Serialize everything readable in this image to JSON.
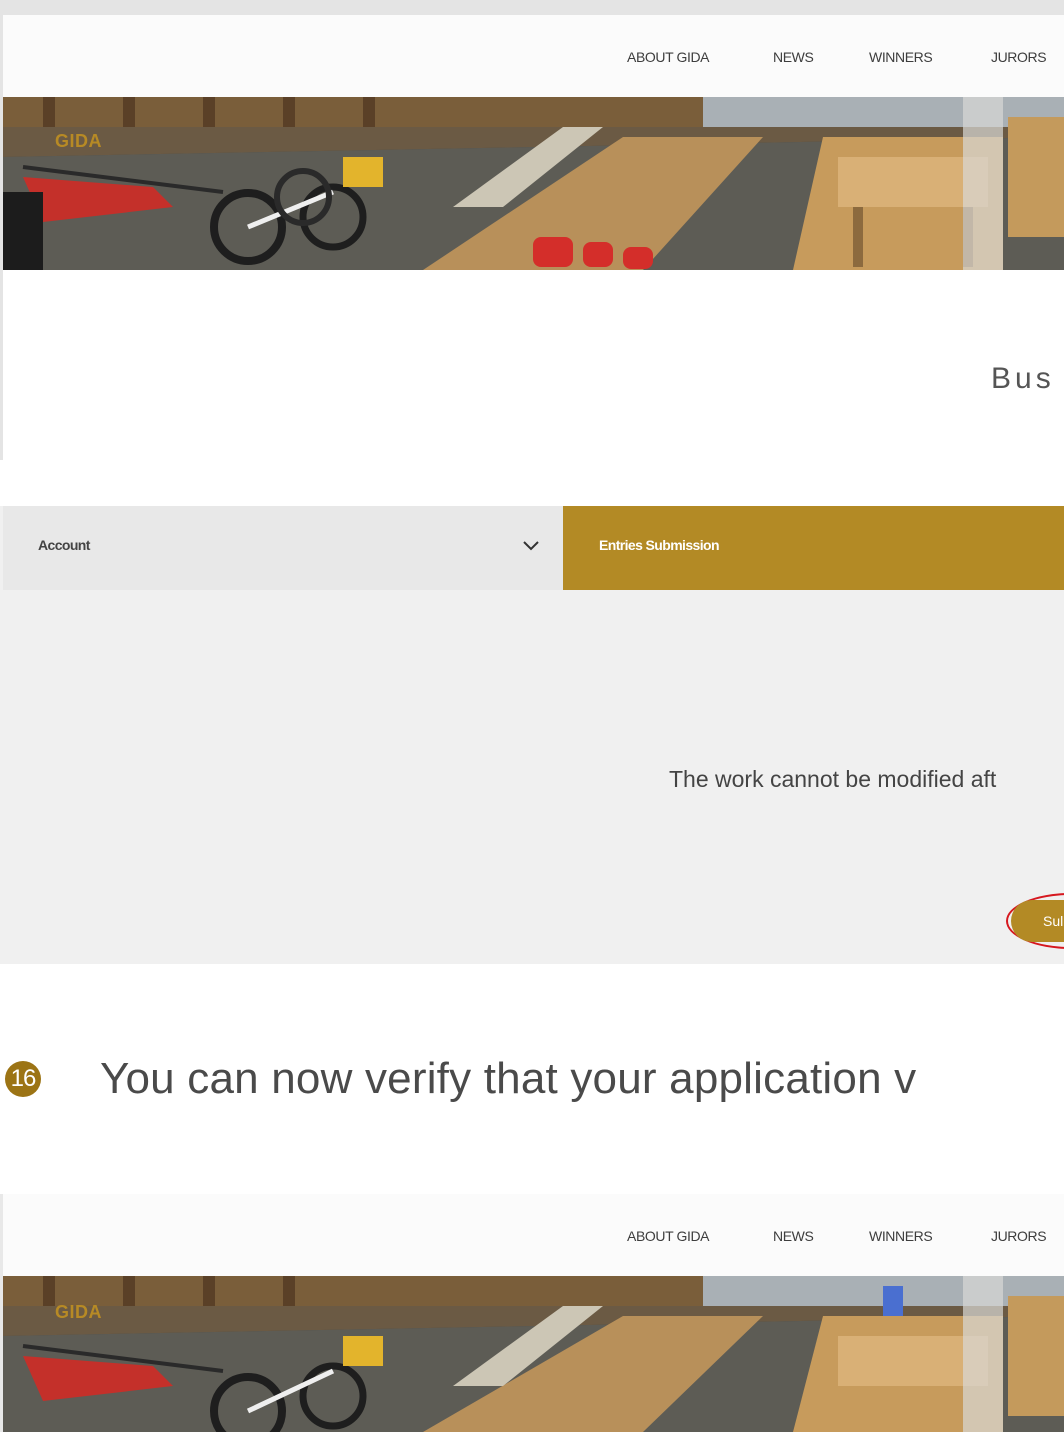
{
  "nav": {
    "items": [
      {
        "label": "ABOUT GIDA"
      },
      {
        "label": "NEWS"
      },
      {
        "label": "WINNERS"
      },
      {
        "label": "JURORS"
      }
    ]
  },
  "banner": {
    "logo_text": "GIDA"
  },
  "page_heading": "Bus",
  "tabs": {
    "account_label": "Account",
    "entries_label": "Entries Submission"
  },
  "panel": {
    "notice": "The work cannot be modified aft",
    "submit_label": "Sul"
  },
  "step": {
    "number": "16",
    "text": "You can now verify that your application v"
  },
  "colors": {
    "brand_gold": "#b38a25",
    "highlight_red": "#d6181f"
  }
}
